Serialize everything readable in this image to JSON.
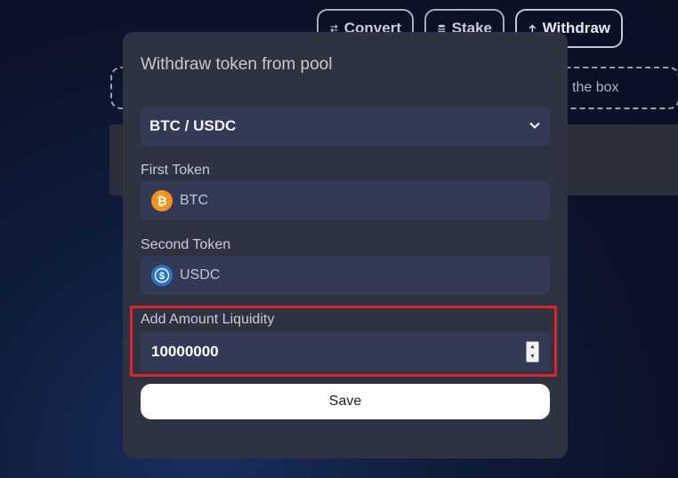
{
  "toolbar": {
    "convert_label": "Convert",
    "stake_label": "Stake",
    "withdraw_label": "Withdraw"
  },
  "background": {
    "dropzone_text": "the box"
  },
  "modal": {
    "title": "Withdraw token from pool",
    "pair_select": {
      "value": "BTC / USDC"
    },
    "first_token": {
      "label": "First Token",
      "value": "BTC",
      "icon": "bitcoin-icon",
      "color": "#f2931a"
    },
    "second_token": {
      "label": "Second Token",
      "value": "USDC",
      "icon": "usdc-icon",
      "color": "#2775ca"
    },
    "amount": {
      "label": "Add Amount Liquidity",
      "value": "10000000"
    },
    "save_label": "Save"
  },
  "colors": {
    "highlight": "#e0202a",
    "modal_bg": "#2e3342",
    "field_bg": "#333a55"
  }
}
